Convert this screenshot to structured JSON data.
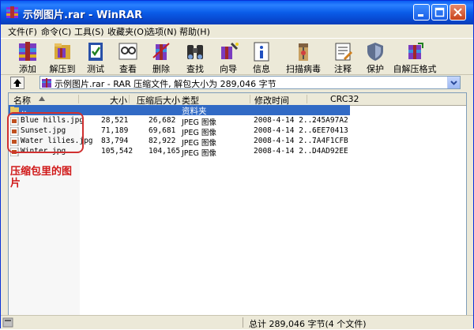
{
  "window": {
    "title": "示例图片.rar - WinRAR"
  },
  "menu": [
    "文件(F)",
    "命令(C)",
    "工具(S)",
    "收藏夹(O)",
    "选项(N)",
    "帮助(H)"
  ],
  "toolbar": [
    "添加",
    "解压到",
    "测试",
    "查看",
    "删除",
    "查找",
    "向导",
    "信息",
    "扫描病毒",
    "注释",
    "保护",
    "自解压格式"
  ],
  "address": {
    "text": "示例图片.rar - RAR 压缩文件, 解包大小为 289,046 字节"
  },
  "columns": [
    "名称",
    "大小",
    "压缩后大小",
    "类型",
    "修改时间",
    "CRC32"
  ],
  "folder_row": {
    "name": "..",
    "type": "资料夹"
  },
  "files": [
    {
      "name": "Blue hills.jpg",
      "size": "28,521",
      "packed": "26,682",
      "type": "JPEG 图像",
      "modified": "2008-4-14 2...",
      "crc": "245A97A2"
    },
    {
      "name": "Sunset.jpg",
      "size": "71,189",
      "packed": "69,681",
      "type": "JPEG 图像",
      "modified": "2008-4-14 2...",
      "crc": "6EE70413"
    },
    {
      "name": "Water lilies.jpg",
      "size": "83,794",
      "packed": "82,922",
      "type": "JPEG 图像",
      "modified": "2008-4-14 2...",
      "crc": "7A4F1CFB"
    },
    {
      "name": "Winter.jpg",
      "size": "105,542",
      "packed": "104,165",
      "type": "JPEG 图像",
      "modified": "2008-4-14 2...",
      "crc": "D4AD92EE"
    }
  ],
  "annotation": "压缩包里的图片",
  "status": {
    "text": "总计 289,046 字节(4 个文件)"
  },
  "colors": {
    "titlebar": "#0a5ce8",
    "selection": "#316ac5",
    "annotation": "#d01818"
  }
}
